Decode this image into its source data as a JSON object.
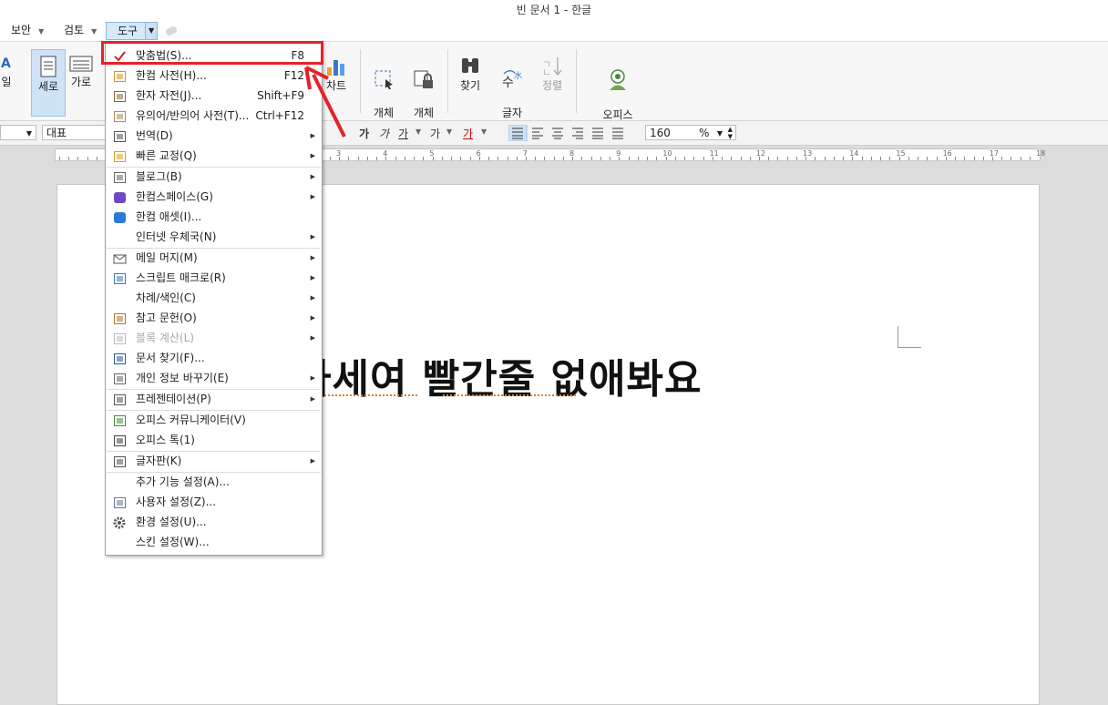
{
  "window": {
    "title": "빈 문서 1 - 한글"
  },
  "menubar": {
    "tabs": [
      {
        "label": "보안"
      },
      {
        "label": "검토"
      },
      {
        "label": "도구"
      }
    ]
  },
  "ribbon": {
    "partial_left_label": "일",
    "vertical_label": "세로",
    "horizontal_label": "가로",
    "chart_label": "차트",
    "object_select_label": "개체\n선택",
    "object_protect_label": "개체\n보호",
    "find_label": "찾기",
    "replace_label": "글자\n바꾸기",
    "sort_label": "정렬",
    "communicator_label": "오피스\n커뮤니케이터"
  },
  "format_bar": {
    "font_name": "대표",
    "font_glyphs": [
      "가",
      "가",
      "가",
      "가",
      "가"
    ],
    "zoom_value": "160",
    "zoom_unit": "%"
  },
  "ruler": {
    "numbers": [
      "3",
      "4",
      "5",
      "6",
      "7",
      "8",
      "9",
      "10",
      "11",
      "12",
      "13",
      "14",
      "15",
      "16",
      "17",
      "18"
    ]
  },
  "document": {
    "text": "하세여  빨간줄  없애봐요"
  },
  "tools_menu": {
    "items": [
      {
        "label": "맞춤법(S)...",
        "shortcut": "F8",
        "submenu": false,
        "disabled": false,
        "icon": "spellcheck-icon"
      },
      {
        "label": "한컴 사전(H)...",
        "shortcut": "F12",
        "submenu": false,
        "disabled": false,
        "icon": "dictionary-icon"
      },
      {
        "label": "한자 자전(J)...",
        "shortcut": "Shift+F9",
        "submenu": false,
        "disabled": false,
        "icon": "hanja-icon"
      },
      {
        "label": "유의어/반의어 사전(T)...",
        "shortcut": "Ctrl+F12",
        "submenu": false,
        "disabled": false,
        "icon": "thesaurus-icon"
      },
      {
        "label": "번역(D)",
        "shortcut": "",
        "submenu": true,
        "disabled": false,
        "icon": "translate-icon"
      },
      {
        "label": "빠른 교정(Q)",
        "shortcut": "",
        "submenu": true,
        "disabled": false,
        "icon": "quick-correct-icon"
      },
      {
        "label": "블로그(B)",
        "shortcut": "",
        "submenu": true,
        "disabled": false,
        "icon": "blog-icon"
      },
      {
        "label": "한컴스페이스(G)",
        "shortcut": "",
        "submenu": true,
        "disabled": false,
        "icon": "hancom-space-icon"
      },
      {
        "label": "한컴 애셋(I)...",
        "shortcut": "",
        "submenu": false,
        "disabled": false,
        "icon": "hancom-asset-icon"
      },
      {
        "label": "인터넷 우체국(N)",
        "shortcut": "",
        "submenu": true,
        "disabled": false,
        "icon": ""
      },
      {
        "label": "메일 머지(M)",
        "shortcut": "",
        "submenu": true,
        "disabled": false,
        "icon": "mail-icon"
      },
      {
        "label": "스크립트 매크로(R)",
        "shortcut": "",
        "submenu": true,
        "disabled": false,
        "icon": "macro-icon"
      },
      {
        "label": "차례/색인(C)",
        "shortcut": "",
        "submenu": true,
        "disabled": false,
        "icon": ""
      },
      {
        "label": "참고 문헌(O)",
        "shortcut": "",
        "submenu": true,
        "disabled": false,
        "icon": "reference-icon"
      },
      {
        "label": "블록 계산(L)",
        "shortcut": "",
        "submenu": true,
        "disabled": true,
        "icon": "calc-icon"
      },
      {
        "label": "문서 찾기(F)...",
        "shortcut": "",
        "submenu": false,
        "disabled": false,
        "icon": "find-doc-icon"
      },
      {
        "label": "개인 정보 바꾸기(E)",
        "shortcut": "",
        "submenu": true,
        "disabled": false,
        "icon": "personal-info-icon"
      },
      {
        "label": "프레젠테이션(P)",
        "shortcut": "",
        "submenu": true,
        "disabled": false,
        "icon": "presentation-icon"
      },
      {
        "label": "오피스 커뮤니케이터(V)",
        "shortcut": "",
        "submenu": false,
        "disabled": false,
        "icon": "communicator-icon"
      },
      {
        "label": "오피스 톡(1)",
        "shortcut": "",
        "submenu": false,
        "disabled": false,
        "icon": "office-talk-icon"
      },
      {
        "label": "글자판(K)",
        "shortcut": "",
        "submenu": true,
        "disabled": false,
        "icon": "keyboard-icon"
      },
      {
        "label": "추가 기능 설정(A)...",
        "shortcut": "",
        "submenu": false,
        "disabled": false,
        "icon": ""
      },
      {
        "label": "사용자 설정(Z)...",
        "shortcut": "",
        "submenu": false,
        "disabled": false,
        "icon": "user-settings-icon"
      },
      {
        "label": "환경 설정(U)...",
        "shortcut": "",
        "submenu": false,
        "disabled": false,
        "icon": "gear-icon"
      },
      {
        "label": "스킨 설정(W)...",
        "shortcut": "",
        "submenu": false,
        "disabled": false,
        "icon": ""
      }
    ]
  },
  "colors": {
    "highlight": "#e6212a",
    "active_tab": "#d6e9f8",
    "squiggle": "#d9822b"
  }
}
